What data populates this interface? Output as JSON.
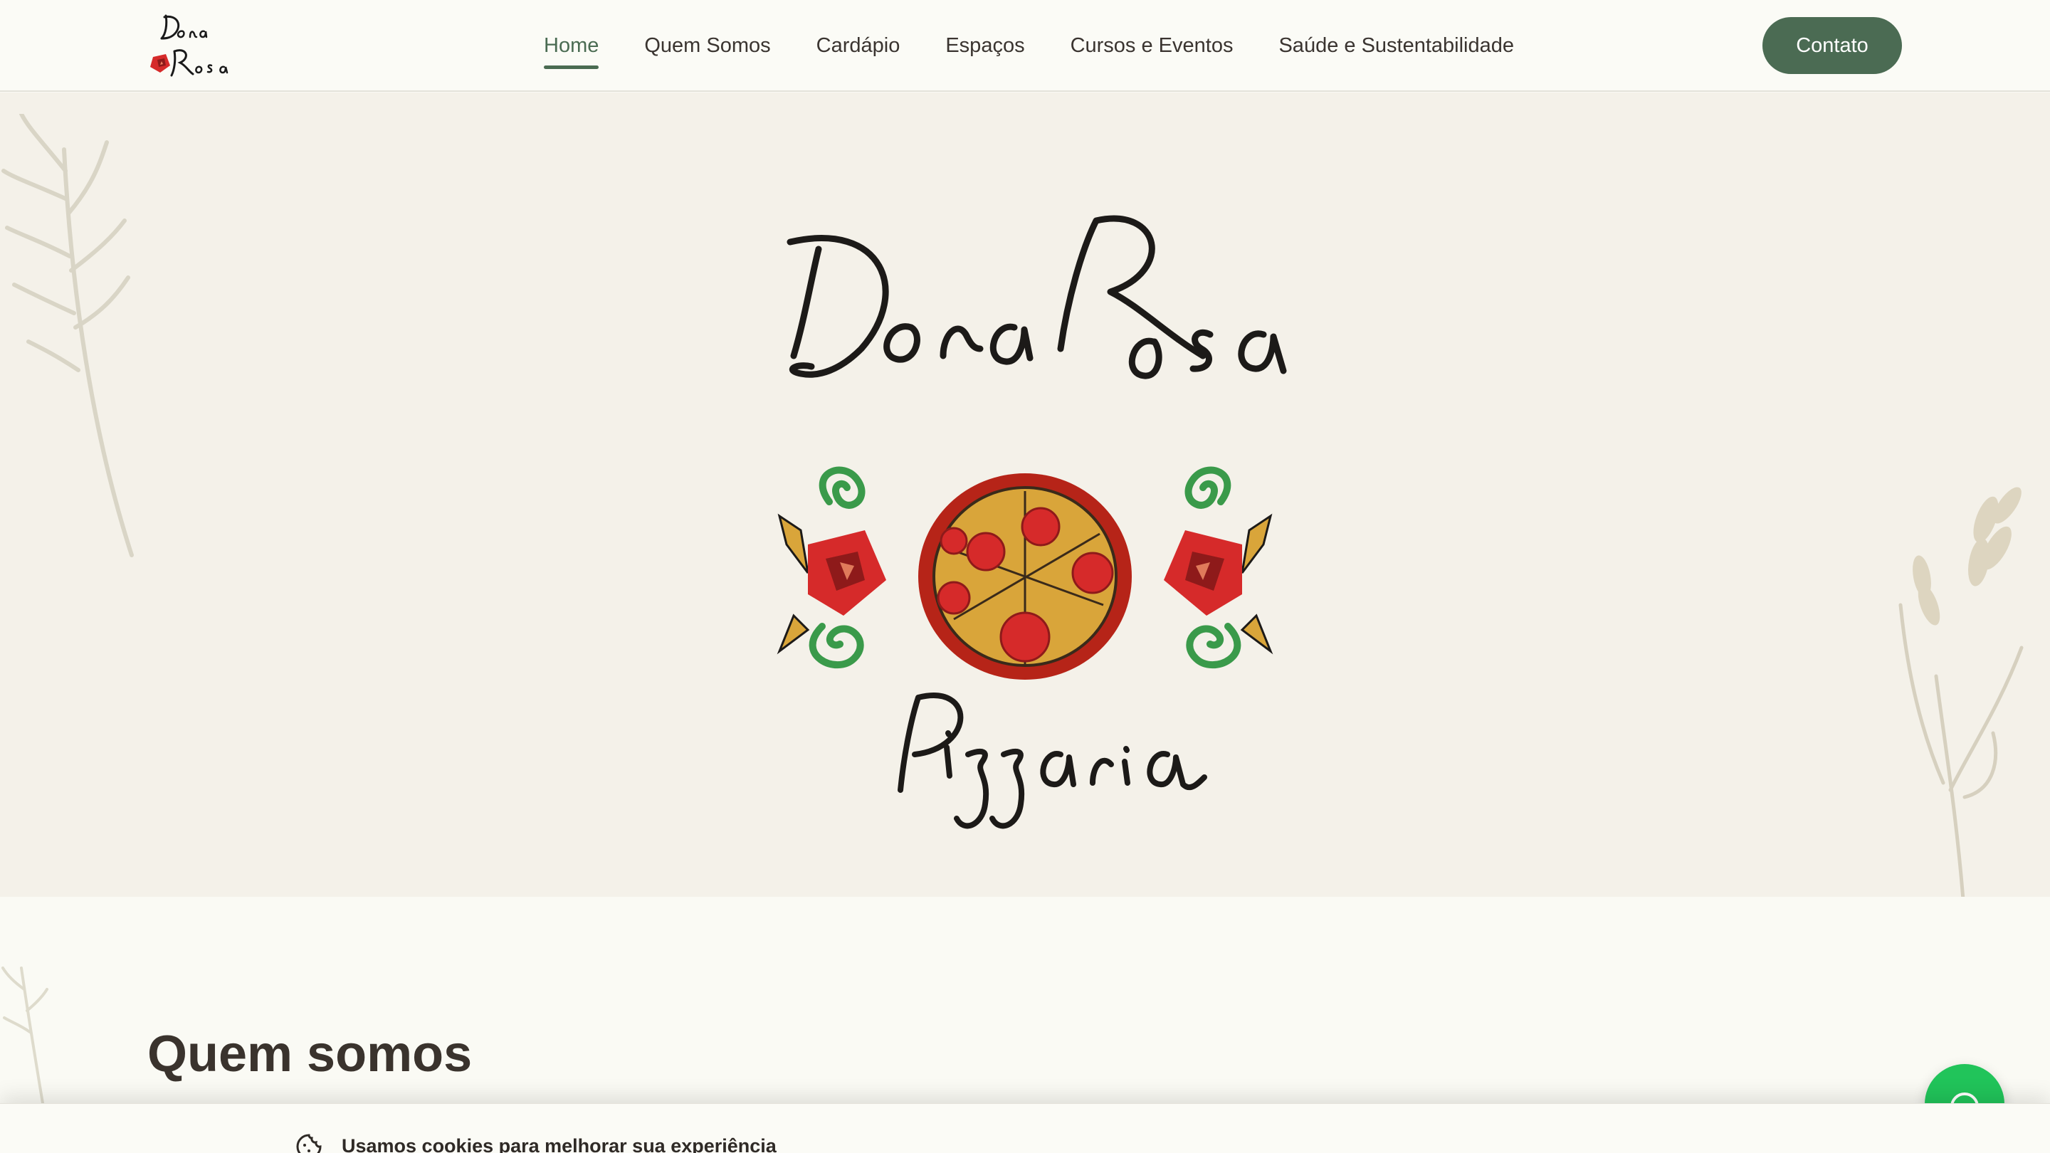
{
  "header": {
    "nav": [
      {
        "label": "Home",
        "active": true
      },
      {
        "label": "Quem Somos"
      },
      {
        "label": "Cardápio"
      },
      {
        "label": "Espaços"
      },
      {
        "label": "Cursos e Eventos"
      },
      {
        "label": "Saúde e Sustentabilidade"
      }
    ],
    "contact_label": "Contato"
  },
  "hero": {
    "logo_brand": "Dona Rosa",
    "logo_sub": "Pizzaria"
  },
  "section": {
    "title": "Quem somos"
  },
  "cookie": {
    "text": "Usamos cookies para melhorar sua experiência",
    "icon": "cookie-icon"
  },
  "chat": {
    "icon": "chat-icon"
  },
  "colors": {
    "accent": "#4b6b53",
    "hero_bg": "#f4f1e9",
    "page_bg": "#fafaf4",
    "chat": "#21c45a",
    "rose": "#d62a2a",
    "leaf": "#3a9a4a",
    "pizza": "#d9a53a"
  }
}
